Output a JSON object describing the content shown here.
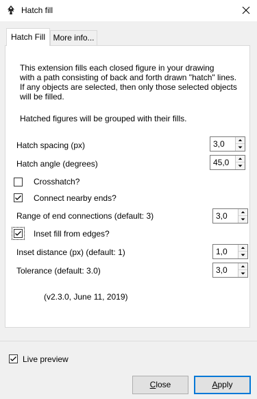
{
  "window": {
    "title": "Hatch fill",
    "close_icon": "close-icon"
  },
  "tabs": [
    {
      "label": "Hatch Fill",
      "active": true
    },
    {
      "label": "More info...",
      "active": false
    }
  ],
  "description": {
    "line1": "This extension fills each closed figure in your drawing",
    "line2": "with a path consisting of back and forth drawn \"hatch\" lines.",
    "line3": "If any objects are selected, then only those selected objects",
    "line4": "will be filled.",
    "line5": "Hatched figures will be grouped with their fills."
  },
  "fields": {
    "hatch_spacing": {
      "label": "Hatch spacing (px)",
      "value": "3,0"
    },
    "hatch_angle": {
      "label": "Hatch angle (degrees)",
      "value": "45,0"
    },
    "crosshatch": {
      "label": "Crosshatch?",
      "checked": false
    },
    "connect_ends": {
      "label": "Connect nearby ends?",
      "checked": true
    },
    "range_end": {
      "label": "Range of end connections (default: 3)",
      "value": "3,0"
    },
    "inset_fill": {
      "label": "Inset fill from edges?",
      "checked": true
    },
    "inset_distance": {
      "label": "Inset distance (px) (default: 1)",
      "value": "1,0"
    },
    "tolerance": {
      "label": "Tolerance (default: 3.0)",
      "value": "3,0"
    }
  },
  "version": "(v2.3.0, June 11, 2019)",
  "live_preview": {
    "label": "Live preview",
    "checked": true
  },
  "buttons": {
    "close": {
      "mnemonic": "C",
      "rest": "lose"
    },
    "apply": {
      "mnemonic": "A",
      "rest": "pply"
    }
  },
  "colors": {
    "accent": "#0078d7",
    "background": "#f0f0f0",
    "panel": "#ffffff"
  }
}
